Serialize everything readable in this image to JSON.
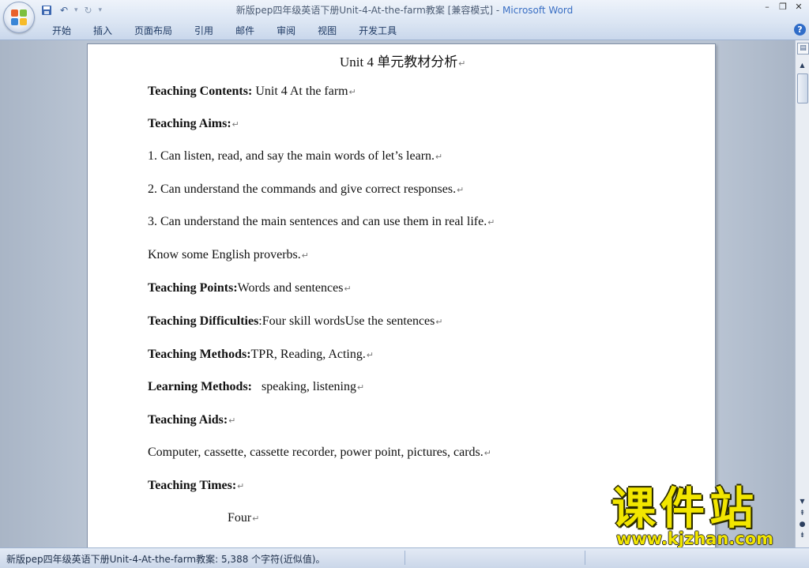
{
  "window": {
    "title_doc": "新版pep四年级英语下册Unit-4-At-the-farm教案 [兼容模式]",
    "title_sep": " - ",
    "title_app": "Microsoft Word"
  },
  "quick_access": {
    "save_icon": "save-icon",
    "undo_icon": "undo-icon",
    "redo_icon": "redo-icon"
  },
  "ribbon": {
    "tabs": [
      "开始",
      "插入",
      "页面布局",
      "引用",
      "邮件",
      "审阅",
      "视图",
      "开发工具"
    ]
  },
  "document": {
    "title": "Unit 4 单元教材分析",
    "contents_label": "Teaching Contents:",
    "contents_value": " Unit 4 At the farm",
    "aims_label": "Teaching Aims:",
    "aims": [
      "1.  Can listen, read, and say the main words of let’s learn.",
      "2.  Can understand the commands and give correct responses.",
      "3.  Can understand the main sentences and can use them in real life."
    ],
    "proverbs": "Know some English proverbs.",
    "points_label": "Teaching Points:",
    "points_value": "Words and sentences",
    "difficulties_label": "Teaching Difficulties",
    "difficulties_value": ":Four skill wordsUse the sentences",
    "methods_label": "Teaching Methods:",
    "methods_value": "TPR, Reading, Acting.",
    "learning_label": "Learning Methods:",
    "learning_value": "   speaking, listening",
    "aids_label": "Teaching Aids:",
    "aids_value": "Computer, cassette, cassette recorder, power point, pictures, cards.",
    "times_label": "Teaching Times:",
    "times_value": "Four",
    "para_mark": "↵"
  },
  "status": {
    "text": "新版pep四年级英语下册Unit-4-At-the-farm教案: 5,388 个字符(近似值)。"
  },
  "watermark": {
    "cn": "课件站",
    "url": "www.kjzhan.com"
  }
}
